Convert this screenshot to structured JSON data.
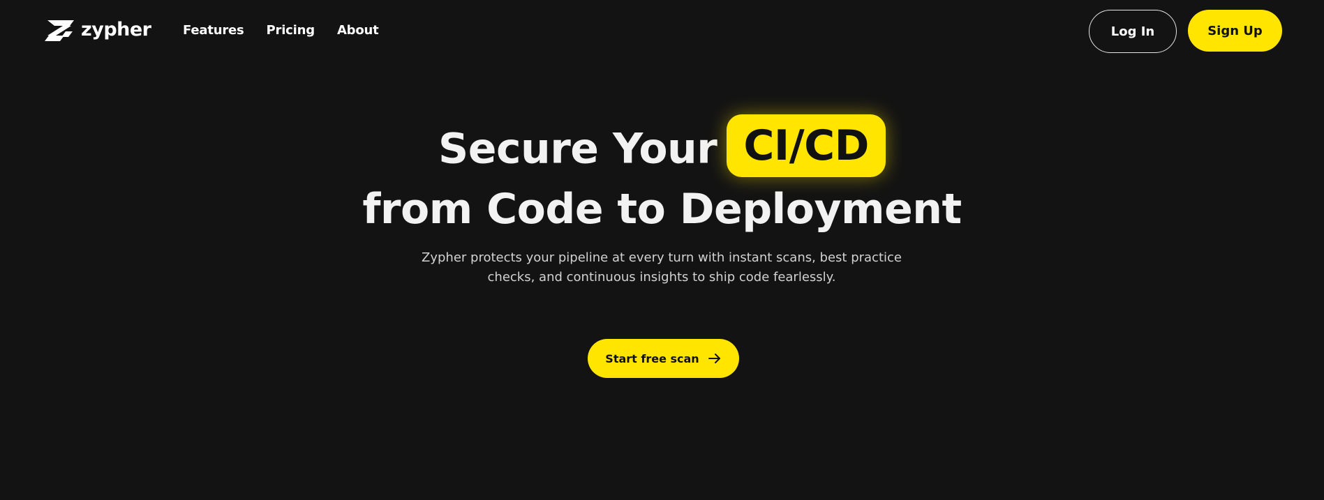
{
  "brand": {
    "name": "zypher",
    "logo_icon": "zypher-z-logo-icon",
    "accent_color": "#ffe500",
    "background_color": "#131313"
  },
  "nav": {
    "items": [
      {
        "label": "Features"
      },
      {
        "label": "Pricing"
      },
      {
        "label": "About"
      }
    ]
  },
  "auth": {
    "login_label": "Log In",
    "signup_label": "Sign Up"
  },
  "hero": {
    "title_part1": "Secure Your",
    "title_highlight": "CI/CD",
    "title_line2": "from Code to Deployment",
    "subtitle_line1": "Zypher protects your pipeline at every turn with instant scans, best practice",
    "subtitle_line2": "checks, and continuous insights to ship code fearlessly.",
    "cta_label": "Start free scan",
    "cta_icon": "arrow-right-icon"
  }
}
